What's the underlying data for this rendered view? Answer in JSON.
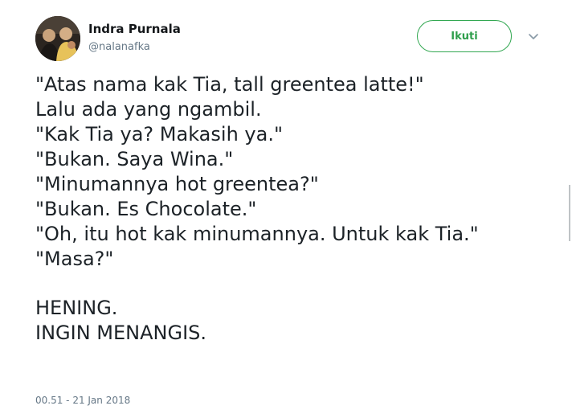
{
  "author": {
    "display_name": "Indra Purnala",
    "handle": "@nalanafka"
  },
  "follow_label": "Ikuti",
  "tweet": {
    "lines": [
      "\"Atas nama kak Tia, tall greentea latte!\"",
      "Lalu ada yang ngambil.",
      "\"Kak Tia ya? Makasih ya.\"",
      "\"Bukan. Saya Wina.\"",
      "\"Minumannya hot greentea?\"",
      "\"Bukan. Es Chocolate.\"",
      "\"Oh, itu hot kak minumannya. Untuk kak Tia.\"",
      "\"Masa?\""
    ],
    "closing_lines": [
      "HENING.",
      "INGIN MENANGIS."
    ],
    "timestamp": "00.51 - 21 Jan 2018"
  },
  "colors": {
    "follow_accent": "#2e9e4b",
    "secondary_text": "#657786"
  },
  "icons": {
    "caret": "chevron-down-icon"
  }
}
